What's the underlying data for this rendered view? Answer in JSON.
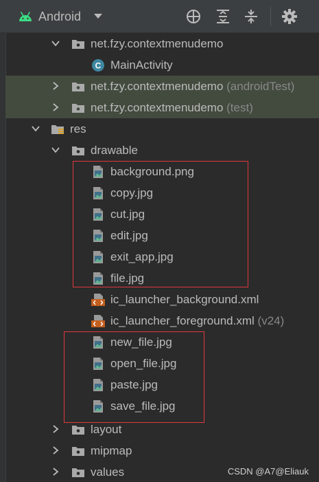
{
  "toolbar": {
    "view_selector_label": "Android",
    "icons": [
      "android-icon",
      "chevron-down-icon",
      "locate-icon",
      "expand-all-icon",
      "collapse-all-icon",
      "gear-icon"
    ]
  },
  "tree": {
    "package_main": "net.fzy.contextmenudemo",
    "main_activity": "MainActivity",
    "package_android_test": "net.fzy.contextmenudemo",
    "package_android_test_suffix": "(androidTest)",
    "package_test": "net.fzy.contextmenudemo",
    "package_test_suffix": "(test)",
    "res": "res",
    "drawable": "drawable",
    "files": [
      {
        "name": "background.png",
        "type": "image"
      },
      {
        "name": "copy.jpg",
        "type": "image"
      },
      {
        "name": "cut.jpg",
        "type": "image"
      },
      {
        "name": "edit.jpg",
        "type": "image"
      },
      {
        "name": "exit_app.jpg",
        "type": "image"
      },
      {
        "name": "file.jpg",
        "type": "image"
      },
      {
        "name": "ic_launcher_background.xml",
        "type": "xml"
      },
      {
        "name": "ic_launcher_foreground.xml",
        "type": "xml",
        "suffix": "(v24)"
      },
      {
        "name": "new_file.jpg",
        "type": "image"
      },
      {
        "name": "open_file.jpg",
        "type": "image"
      },
      {
        "name": "paste.jpg",
        "type": "image"
      },
      {
        "name": "save_file.jpg",
        "type": "image"
      }
    ],
    "layout": "layout",
    "mipmap": "mipmap",
    "values": "values"
  },
  "watermark": "CSDN @A7@Eliauk",
  "colors": {
    "background": "#2b2b2b",
    "toolbar": "#3c3f41",
    "highlight_row": "#434b3f",
    "selection_box": "#e0393e",
    "android_green": "#3ddc84",
    "class_icon": "#3e86a0",
    "xml_icon": "#c45f1e"
  }
}
